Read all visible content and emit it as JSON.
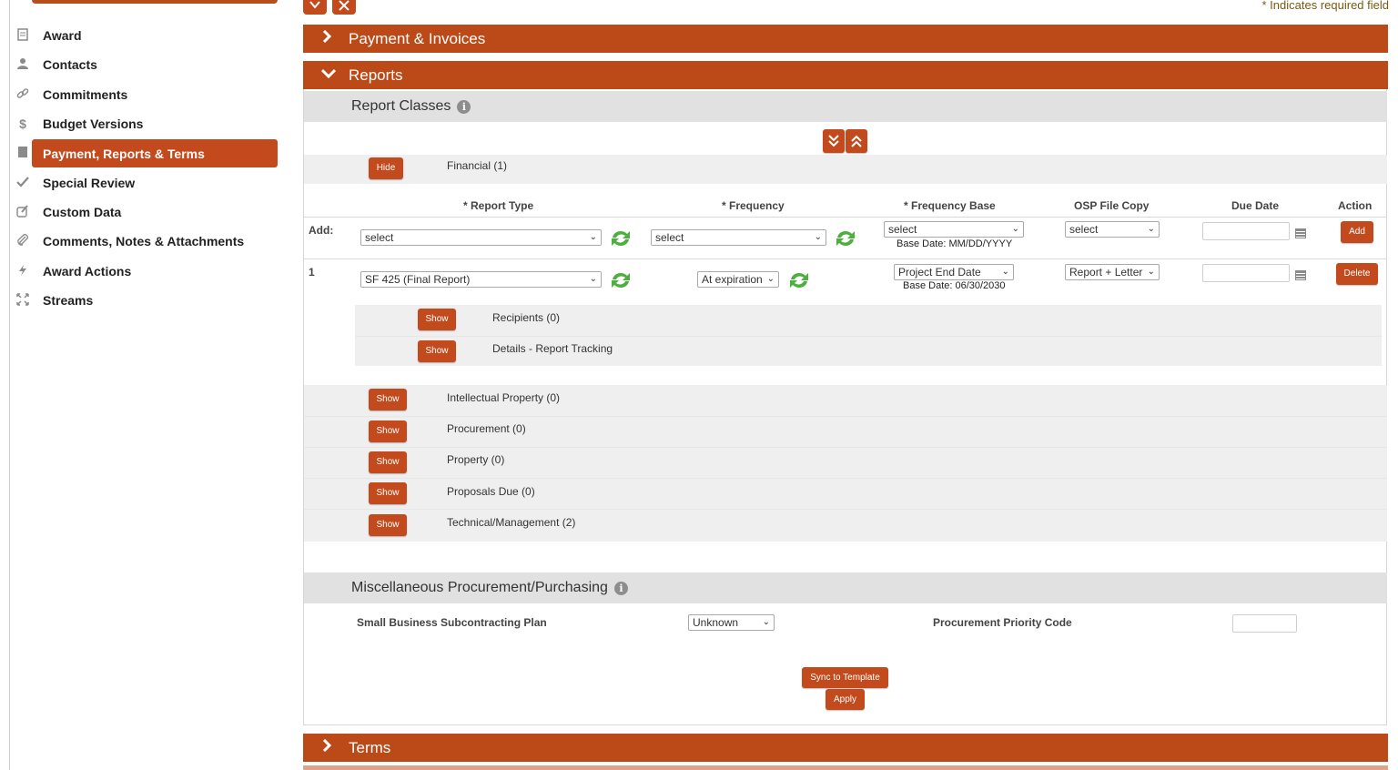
{
  "sidebar": {
    "items": [
      {
        "label": "Award",
        "icon": "document-icon",
        "active": false
      },
      {
        "label": "Contacts",
        "icon": "person-icon",
        "active": false
      },
      {
        "label": "Commitments",
        "icon": "link-icon",
        "active": false
      },
      {
        "label": "Budget Versions",
        "icon": "dollar-icon",
        "active": false
      },
      {
        "label": "Payment, Reports & Terms",
        "icon": "book-icon",
        "active": true
      },
      {
        "label": "Special Review",
        "icon": "checkmark-icon",
        "active": false
      },
      {
        "label": "Custom Data",
        "icon": "edit-icon",
        "active": false
      },
      {
        "label": "Comments, Notes & Attachments",
        "icon": "paperclip-icon",
        "active": false
      },
      {
        "label": "Award Actions",
        "icon": "lightning-icon",
        "active": false
      },
      {
        "label": "Streams",
        "icon": "expand-icon",
        "active": false
      }
    ]
  },
  "header": {
    "required_note": "* Indicates required field"
  },
  "sections": {
    "payment": {
      "title": "Payment & Invoices"
    },
    "reports": {
      "title": "Reports"
    },
    "terms": {
      "title": "Terms"
    }
  },
  "report_classes": {
    "title": "Report Classes",
    "financial": {
      "label": "Financial (1)",
      "button": "Hide"
    },
    "columns": {
      "report_type": "* Report Type",
      "frequency": "*  Frequency",
      "frequency_base": "*  Frequency Base",
      "osp_file_copy": "OSP File Copy",
      "due_date": "Due Date",
      "action": "Action"
    },
    "add_row": {
      "label": "Add:",
      "report_type": "select",
      "frequency": "select",
      "frequency_base": "select",
      "base_date": "Base Date: MM/DD/YYYY",
      "osp_file_copy": "select",
      "due_date": "",
      "action": "Add"
    },
    "row1": {
      "index": "1",
      "report_type": "SF 425 (Final Report)",
      "frequency": "At expiration",
      "frequency_base": "Project End Date",
      "base_date": "Base Date: 06/30/2030",
      "osp_file_copy": "Report + Letter",
      "due_date": "",
      "action": "Delete",
      "sub": [
        {
          "label": "Recipients (0)",
          "button": "Show"
        },
        {
          "label": "Details - Report Tracking",
          "button": "Show"
        }
      ]
    },
    "other_classes": [
      {
        "label": "Intellectual Property (0)",
        "button": "Show"
      },
      {
        "label": "Procurement (0)",
        "button": "Show"
      },
      {
        "label": "Property (0)",
        "button": "Show"
      },
      {
        "label": "Proposals Due (0)",
        "button": "Show"
      },
      {
        "label": "Technical/Management (2)",
        "button": "Show"
      }
    ]
  },
  "misc": {
    "title": "Miscellaneous Procurement/Purchasing",
    "small_business_label": "Small Business Subcontracting Plan",
    "small_business_value": "Unknown",
    "priority_label": "Procurement Priority Code",
    "priority_value": ""
  },
  "buttons": {
    "sync": "Sync to Template",
    "apply": "Apply"
  },
  "colors": {
    "accent": "#c24a1c",
    "section_bar": "#bb4a18",
    "subheader": "#e1e1e1",
    "band": "#efefef",
    "refresh": "#4caf3e"
  }
}
